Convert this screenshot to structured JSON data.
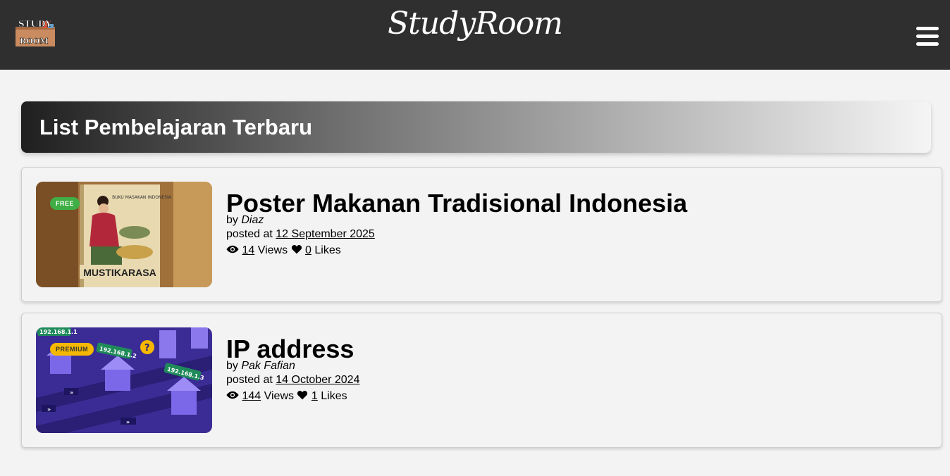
{
  "header": {
    "logo_text_top": "STUDY",
    "logo_text_bottom": "ROOM",
    "brand": "StudyRoom",
    "menu_icon": "hamburger-menu-icon"
  },
  "section": {
    "title": "List Pembelajaran Terbaru"
  },
  "posts": [
    {
      "badge": "FREE",
      "thumb_title_small": "BUKU MASAKAN INDONESIA",
      "thumb_title": "MUSTIKARASA",
      "title": "Poster Makanan Tradisional Indonesia",
      "by_prefix": "by",
      "author": "Diaz",
      "posted_prefix": "posted at",
      "date": "12 September 2025",
      "views": "14",
      "views_label": "Views",
      "likes": "0",
      "likes_label": "Likes"
    },
    {
      "badge": "PREMIUM",
      "thumb_ip1": "192.168.1.1",
      "thumb_ip2": "192.168.1.2",
      "thumb_ip3": "192.168.1.3",
      "title": "IP address",
      "by_prefix": "by",
      "author": "Pak Fafian",
      "posted_prefix": "posted at",
      "date": "14 October 2024",
      "views": "144",
      "views_label": "Views",
      "likes": "1",
      "likes_label": "Likes"
    }
  ],
  "icons": {
    "views": "eye-icon",
    "likes": "heart-icon"
  },
  "colors": {
    "topbar": "#2f2f30",
    "free": "#3fae45",
    "premium": "#f6b800"
  }
}
